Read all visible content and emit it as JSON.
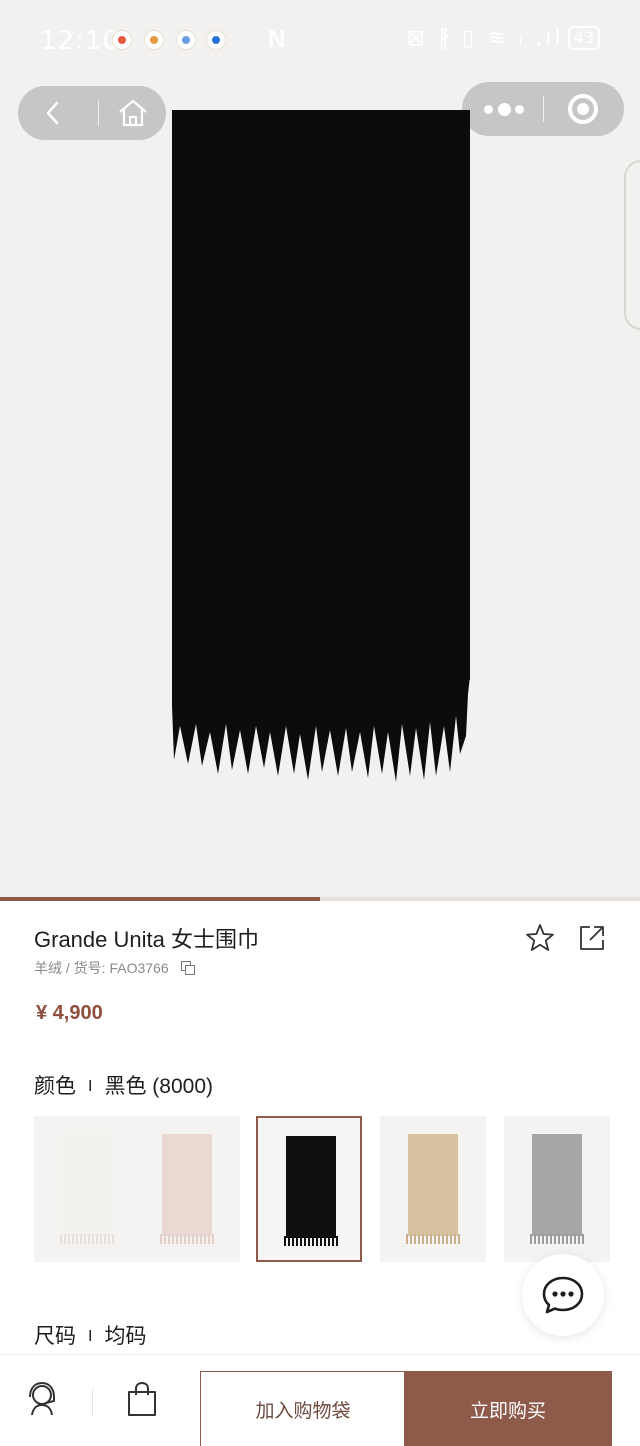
{
  "status_bar": {
    "time": "12:10",
    "app_icon_colors": [
      "#e15a3c",
      "#e79a3d",
      "#6a9ee0",
      "#2d6fd8"
    ],
    "right_indicators": "⊠ ∦ ▯ ≋ ᵢ .ıl",
    "battery": "43"
  },
  "nav": {
    "back_icon": "chevron-left-icon",
    "home_icon": "home-icon",
    "more_icon": "more-dots-icon",
    "close_icon": "target-circle-icon"
  },
  "gallery": {
    "progress": 0.5,
    "scarf_color": "#0d0b0b"
  },
  "product": {
    "title": "Grande Unita 女士围巾",
    "meta": "羊绒 / 货号:  FAO3766",
    "price": "¥ 4,900",
    "color_label": "颜色",
    "color_value": "黑色 (8000)",
    "size_label": "尺码",
    "size_value": "均码",
    "separator": "I",
    "swatches": [
      {
        "color": "#f2f1ee",
        "fringe": "#e6e2d9",
        "selected": false
      },
      {
        "color": "#ead9d3",
        "fringe": "#e4cfc7",
        "selected": false
      },
      {
        "color": "#111010",
        "fringe": "#111010",
        "selected": true
      },
      {
        "color": "#d8c2a0",
        "fringe": "#c9b08a",
        "selected": false
      },
      {
        "color": "#a4a6a8",
        "fringe": "#9a9c9e",
        "selected": false
      }
    ]
  },
  "actions": {
    "favorite_icon": "star-icon",
    "share_icon": "share-icon",
    "chat_icon": "chat-bubble-icon",
    "service_icon": "customer-service-icon",
    "bag_icon": "shopping-bag-icon",
    "add_to_bag": "加入购物袋",
    "buy_now": "立即购买"
  }
}
